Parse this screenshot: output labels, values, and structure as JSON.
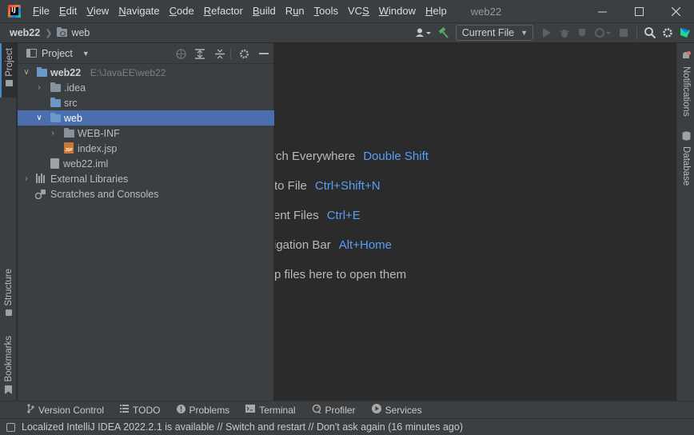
{
  "titlebar": {
    "menu": [
      {
        "pre": "",
        "u": "F",
        "post": "ile"
      },
      {
        "pre": "",
        "u": "E",
        "post": "dit"
      },
      {
        "pre": "",
        "u": "V",
        "post": "iew"
      },
      {
        "pre": "",
        "u": "N",
        "post": "avigate"
      },
      {
        "pre": "",
        "u": "C",
        "post": "ode"
      },
      {
        "pre": "",
        "u": "R",
        "post": "efactor"
      },
      {
        "pre": "",
        "u": "B",
        "post": "uild"
      },
      {
        "pre": "R",
        "u": "u",
        "post": "n"
      },
      {
        "pre": "",
        "u": "T",
        "post": "ools"
      },
      {
        "pre": "VC",
        "u": "S",
        "post": ""
      },
      {
        "pre": "",
        "u": "W",
        "post": "indow"
      },
      {
        "pre": "",
        "u": "H",
        "post": "elp"
      }
    ],
    "window_title": "web22",
    "logo_text": "IJ"
  },
  "navbar": {
    "project": "web22",
    "folder": "web",
    "run_config": "Current File"
  },
  "left_tabs": {
    "project": "Project",
    "structure": "Structure",
    "bookmarks": "Bookmarks"
  },
  "right_tabs": {
    "notifications": "Notifications",
    "database": "Database"
  },
  "project_panel": {
    "title": "Project",
    "tree": {
      "root_label": "web22",
      "root_path": "E:\\JavaEE\\web22",
      "idea": ".idea",
      "src": "src",
      "web": "web",
      "webinf": "WEB-INF",
      "indexjsp": "index.jsp",
      "iml": "web22.iml",
      "extlib": "External Libraries",
      "scratches": "Scratches and Consoles"
    }
  },
  "editor": {
    "hints": [
      {
        "text": "rch Everywhere",
        "key": "Double Shift"
      },
      {
        "text": "to File",
        "key": "Ctrl+Shift+N"
      },
      {
        "text": "ent Files",
        "key": "Ctrl+E"
      },
      {
        "text": "igation Bar",
        "key": "Alt+Home"
      },
      {
        "text": "p files here to open them",
        "key": ""
      }
    ]
  },
  "bottom_tabs": {
    "version_control": "Version Control",
    "todo": "TODO",
    "problems": "Problems",
    "terminal": "Terminal",
    "profiler": "Profiler",
    "services": "Services"
  },
  "statusbar": {
    "message": "Localized IntelliJ IDEA 2022.2.1 is available // Switch and restart // Don't ask again (16 minutes ago)"
  },
  "colors": {
    "background": "#2b2b2b",
    "panel": "#3c3f41",
    "selection": "#4b6eaf",
    "shortcut_key": "#589df6",
    "run_hammer": "#59a869"
  }
}
